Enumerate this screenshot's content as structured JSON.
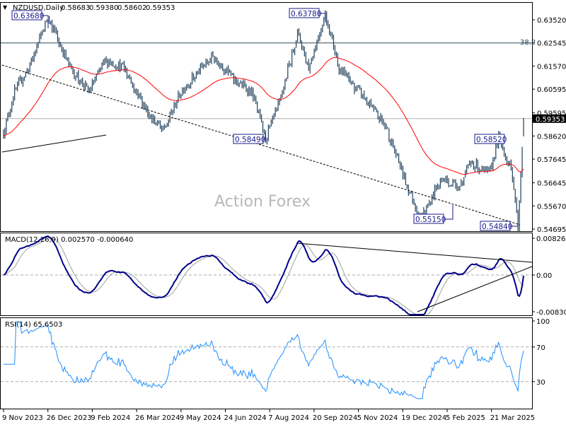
{
  "chart_data": {
    "type": "line",
    "title": "NZDUSD,Daily",
    "ohlc_last": {
      "open": "0.58683",
      "high": "0.59380",
      "low": "0.58602",
      "close": "0.59353"
    },
    "current_price": "0.59353",
    "price_axis": {
      "ticks": [
        "0.63520",
        "0.62545",
        "0.61570",
        "0.60595",
        "0.59595",
        "0.58620",
        "0.57645",
        "0.56645",
        "0.55670",
        "0.54695"
      ],
      "ylim": [
        0.54695,
        0.6352
      ]
    },
    "x_ticks": [
      "9 Nov 2023",
      "26 Dec 2023",
      "9 Feb 2024",
      "26 Mar 2024",
      "9 May 2024",
      "24 Jun 2024",
      "7 Aug 2024",
      "20 Sep 2024",
      "5 Nov 2024",
      "19 Dec 2024",
      "5 Feb 2025",
      "21 Mar 2025"
    ],
    "anchor_points_bar_index_price": [
      [
        0,
        0.588
      ],
      [
        8,
        0.605
      ],
      [
        20,
        0.617
      ],
      [
        32,
        0.6368
      ],
      [
        48,
        0.615
      ],
      [
        61,
        0.605
      ],
      [
        74,
        0.618
      ],
      [
        87,
        0.615
      ],
      [
        102,
        0.598
      ],
      [
        115,
        0.588
      ],
      [
        128,
        0.605
      ],
      [
        151,
        0.62
      ],
      [
        166,
        0.61
      ],
      [
        179,
        0.605
      ],
      [
        189,
        0.5849
      ],
      [
        199,
        0.6
      ],
      [
        212,
        0.63
      ],
      [
        220,
        0.615
      ],
      [
        232,
        0.6378
      ],
      [
        242,
        0.615
      ],
      [
        263,
        0.6
      ],
      [
        276,
        0.59
      ],
      [
        291,
        0.565
      ],
      [
        301,
        0.5515
      ],
      [
        316,
        0.568
      ],
      [
        329,
        0.565
      ],
      [
        337,
        0.575
      ],
      [
        350,
        0.57
      ],
      [
        357,
        0.5852
      ],
      [
        367,
        0.57
      ],
      [
        371,
        0.5484
      ],
      [
        375,
        0.5935
      ]
    ],
    "annotations": [
      "0.63680",
      "0.63780",
      "0.58490",
      "0.58520",
      "0.55150",
      "0.54840"
    ],
    "fib_label": "38.2",
    "fib_level": 0.62545,
    "watermark": "Action Forex",
    "macd": {
      "label": "MACD(12,26,9) 0.002570 -0.000640",
      "ticks": [
        "0.008265",
        "0.00",
        "-0.008307"
      ],
      "ylim": [
        -0.008307,
        0.008265
      ]
    },
    "rsi": {
      "label": "RSI(14) 65.6503",
      "ticks": [
        "100",
        "70",
        "30"
      ]
    },
    "colors": {
      "bars": "#1f3f5a",
      "ma": "#ff0000",
      "macd": "#00008b",
      "signal": "#a0a0a0",
      "rsi": "#1e90ff",
      "annot": "#1a1a8c"
    }
  }
}
